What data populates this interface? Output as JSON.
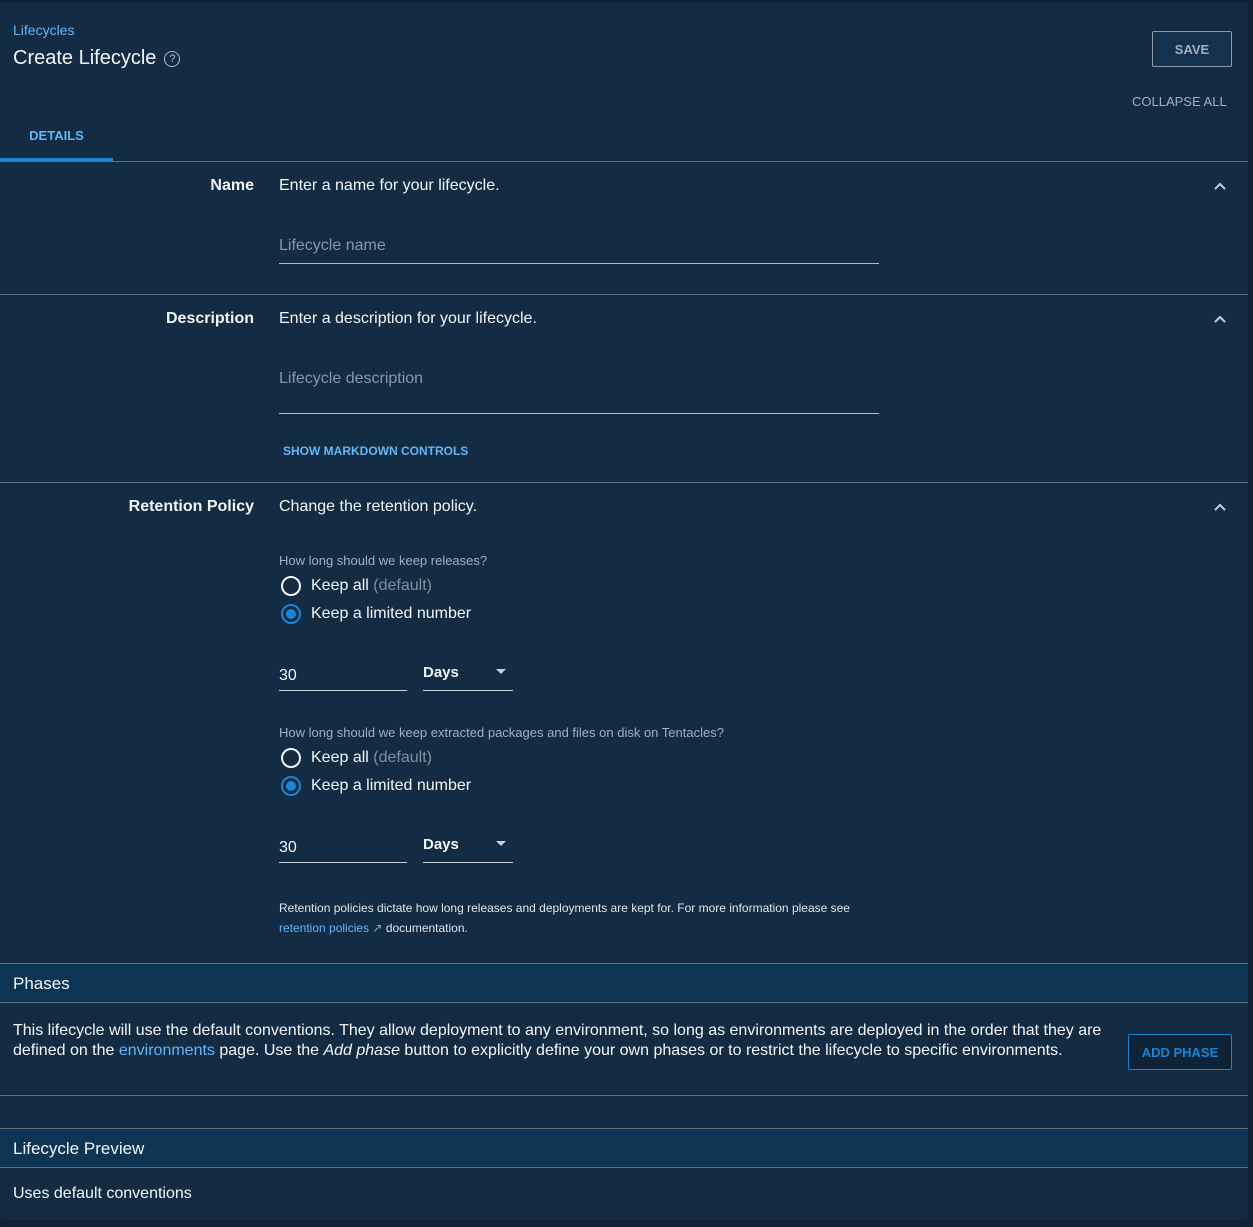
{
  "header": {
    "breadcrumb": "Lifecycles",
    "title": "Create Lifecycle",
    "save_label": "SAVE",
    "collapse_all_label": "COLLAPSE ALL"
  },
  "tabs": [
    {
      "label": "DETAILS",
      "active": true
    }
  ],
  "name_section": {
    "label": "Name",
    "description": "Enter a name for your lifecycle.",
    "placeholder": "Lifecycle name",
    "value": ""
  },
  "description_section": {
    "label": "Description",
    "description": "Enter a description for your lifecycle.",
    "placeholder": "Lifecycle description",
    "value": "",
    "markdown_toggle": "SHOW MARKDOWN CONTROLS"
  },
  "retention": {
    "label": "Retention Policy",
    "description": "Change the retention policy.",
    "releases": {
      "question": "How long should we keep releases?",
      "option_all": "Keep all",
      "option_all_suffix": "(default)",
      "option_limited": "Keep a limited number",
      "selected": "limited",
      "quantity": "30",
      "unit": "Days"
    },
    "files": {
      "question": "How long should we keep extracted packages and files on disk on Tentacles?",
      "option_all": "Keep all",
      "option_all_suffix": "(default)",
      "option_limited": "Keep a limited number",
      "selected": "limited",
      "quantity": "30",
      "unit": "Days"
    },
    "note_prefix": "Retention policies dictate how long releases and deployments are kept for. For more information please see",
    "note_link": "retention policies",
    "note_suffix": "documentation."
  },
  "phases": {
    "title": "Phases",
    "text_1": "This lifecycle will use the default conventions. They allow deployment to any environment, so long as environments are deployed in the order that they are defined on the",
    "link": "environments",
    "text_2": "page. Use the",
    "emphasis": "Add phase",
    "text_3": "button to explicitly define your own phases or to restrict the lifecycle to specific environments.",
    "add_label": "ADD PHASE"
  },
  "preview": {
    "title": "Lifecycle Preview",
    "text": "Uses default conventions"
  },
  "colors": {
    "background": "#132c43",
    "accent": "#1a85d8",
    "link": "#64b5f6",
    "band": "#0e3454"
  }
}
